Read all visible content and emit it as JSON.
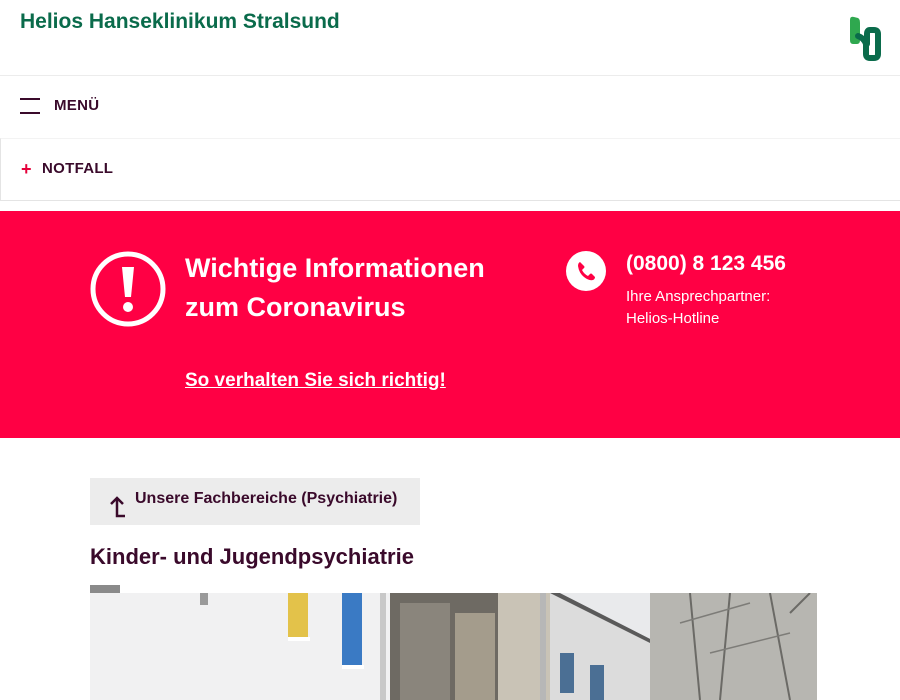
{
  "header": {
    "site_title": "Helios Hanseklinikum Stralsund",
    "logo_icon": "helios-logo-icon",
    "brand_green": "#0a6b4b"
  },
  "nav": {
    "menu_label": "MENÜ",
    "menu_icon": "hamburger-icon",
    "notfall_label": "NOTFALL",
    "notfall_icon": "plus-icon"
  },
  "alert": {
    "background": "#ff0044",
    "icon": "exclamation-circle-icon",
    "title": "Wichtige Informationen zum Coronavirus",
    "link": "So verhalten Sie sich richtig!",
    "phone_icon": "phone-icon",
    "phone_number": "(0800) 8 123 456",
    "phone_desc_line1": "Ihre Ansprechpartner:",
    "phone_desc_line2": "Helios-Hotline"
  },
  "breadcrumb": {
    "back_icon": "arrow-up-left-icon",
    "back_label": "Unsere Fachbereiche (Psychiatrie)"
  },
  "main": {
    "page_title": "Kinder- und Jugendpsychiatrie",
    "hero_image": "building-photo"
  }
}
